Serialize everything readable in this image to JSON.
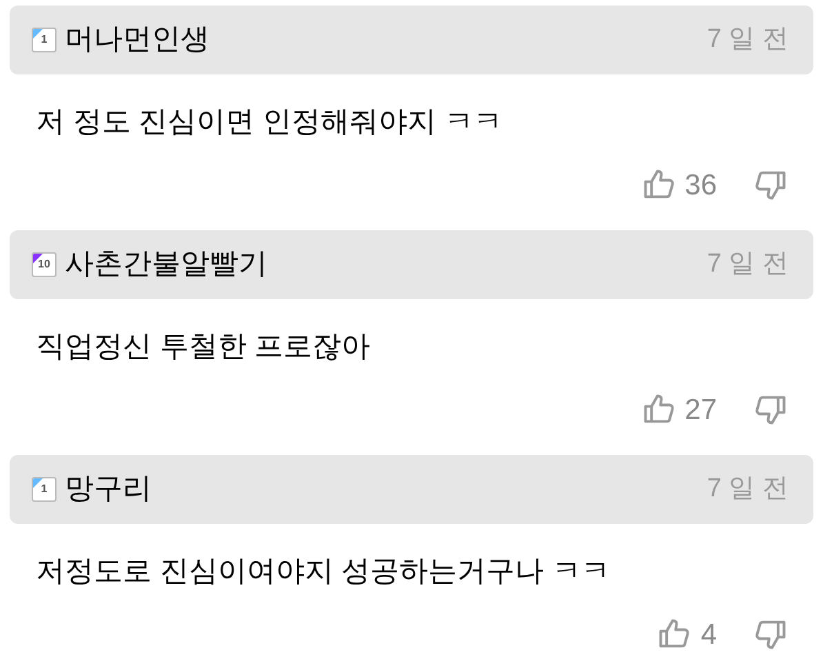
{
  "comments": [
    {
      "level": "1",
      "color": "#66bbff",
      "author": "머나먼인생",
      "time": "7 일 전",
      "text": "저 정도 진심이면 인정해줘야지 ㅋㅋ",
      "likes": "36"
    },
    {
      "level": "10",
      "color": "#8833ff",
      "author": "사촌간불알빨기",
      "time": "7 일 전",
      "text": "직업정신 투철한 프로잖아",
      "likes": "27"
    },
    {
      "level": "1",
      "color": "#66bbff",
      "author": "망구리",
      "time": "7 일 전",
      "text": "저정도로 진심이여야지 성공하는거구나 ㅋㅋ",
      "likes": "4"
    }
  ]
}
